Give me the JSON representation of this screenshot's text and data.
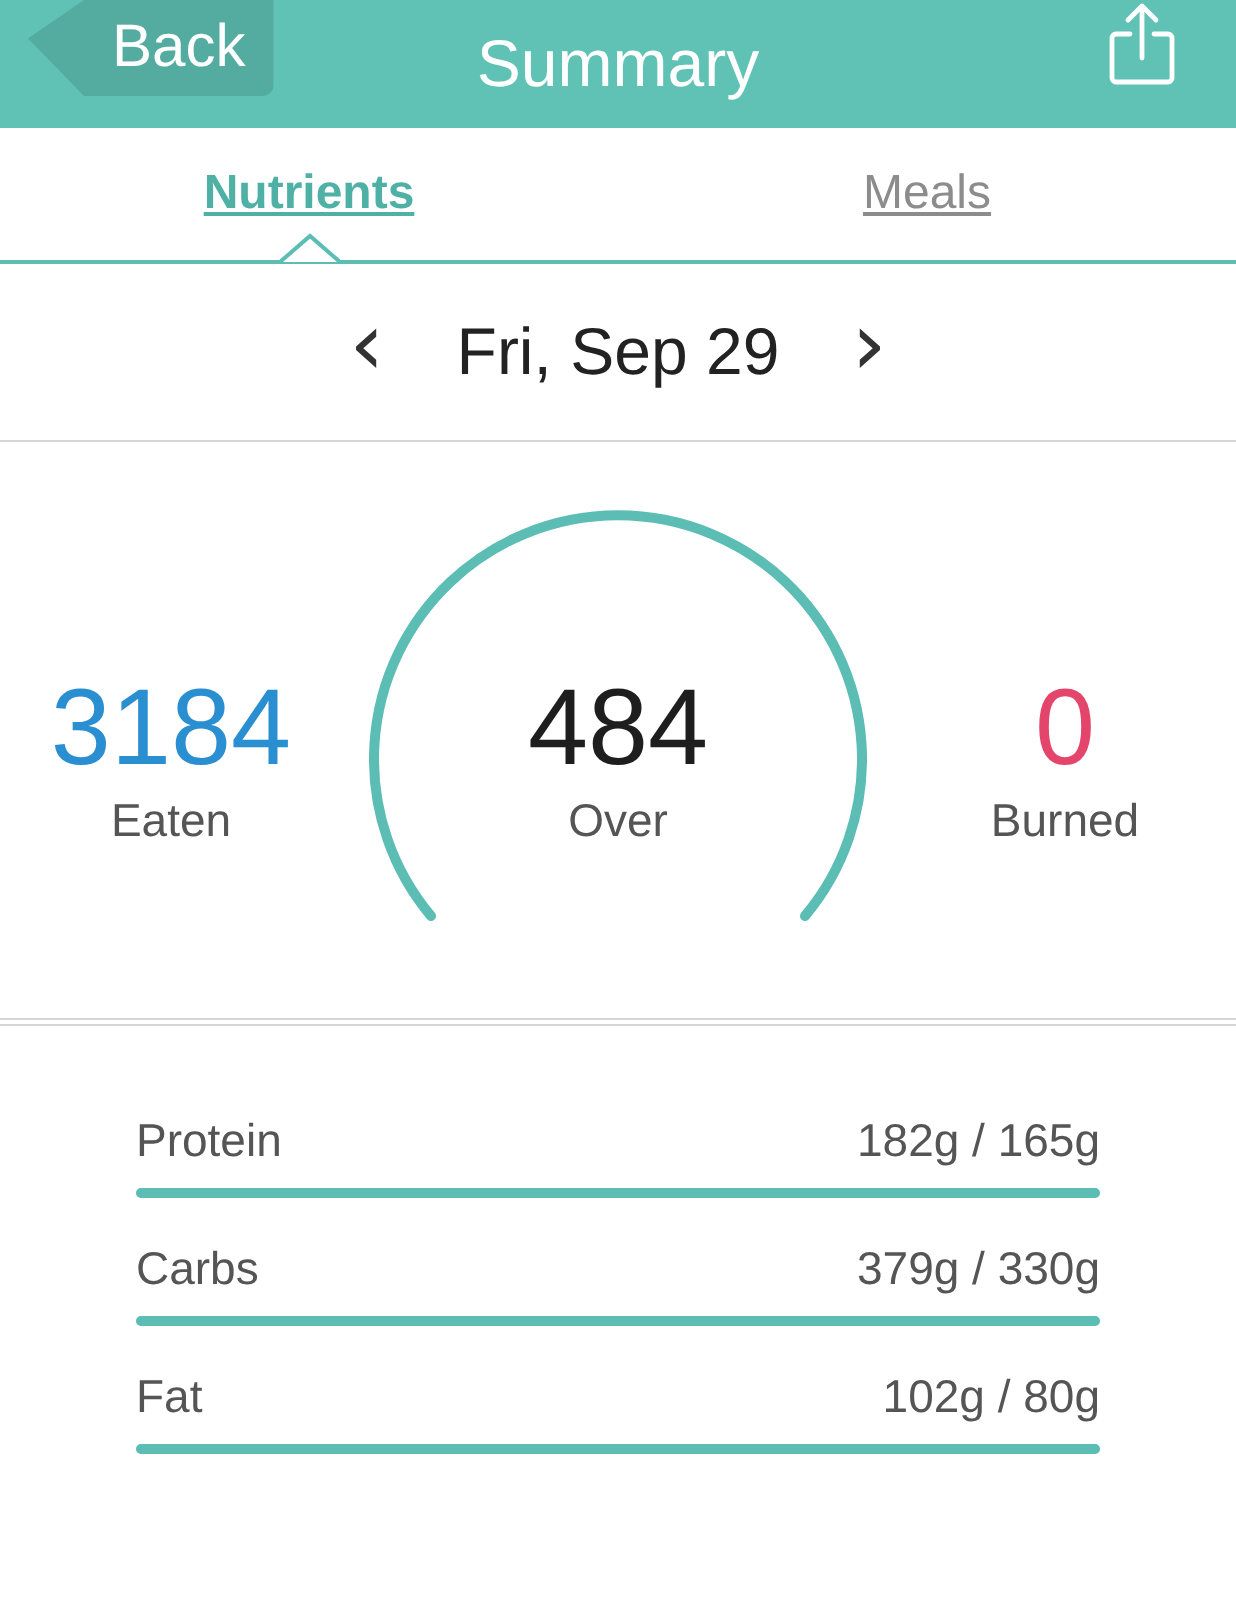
{
  "header": {
    "back": "Back",
    "title": "Summary"
  },
  "tabs": [
    {
      "label": "Nutrients",
      "selected": true
    },
    {
      "label": "Meals",
      "selected": false
    }
  ],
  "date": {
    "prev": "‹",
    "label": "Fri, Sep 29",
    "next": "›"
  },
  "stats": [
    {
      "value": "3184",
      "label": "Eaten",
      "color": "#2a8fd1"
    },
    {
      "value": "484",
      "label": "Over",
      "color": "#1e1e1e"
    },
    {
      "value": "0",
      "label": "Burned",
      "color": "#e3456b"
    }
  ],
  "macros": [
    {
      "name": "Protein",
      "amount": "182g / 165g",
      "level": 1
    },
    {
      "name": "Carbs",
      "amount": "379g / 330g",
      "level": 1
    },
    {
      "name": "Fat",
      "amount": "102g / 80g",
      "level": 1
    }
  ]
}
